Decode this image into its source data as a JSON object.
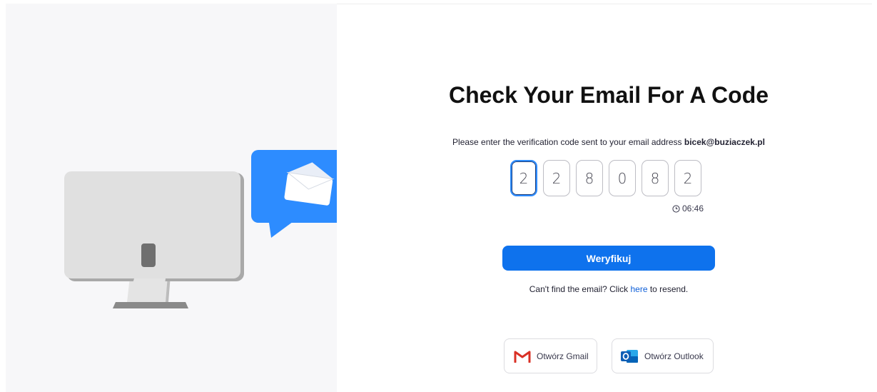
{
  "heading": "Check Your Email For A Code",
  "instruction": {
    "text": "Please enter the verification code sent to your email address",
    "email": "bicek@buziaczek.pl"
  },
  "code": {
    "digits": [
      "2",
      "2",
      "8",
      "0",
      "8",
      "2"
    ],
    "timer": "06:46"
  },
  "verify_button": "Weryfikuj",
  "resend": {
    "prefix": "Can't find the email? Click",
    "link": "here",
    "suffix": "to resend."
  },
  "mail_buttons": {
    "gmail": "Otwórz Gmail",
    "outlook": "Otwórz Outlook"
  },
  "colors": {
    "accent": "#0e72ed",
    "bubble": "#2d8cff",
    "link": "#0e5fd8",
    "left_panel": "#f7f7f9"
  },
  "icons": [
    "monitor-illustration",
    "email-bubble-icon",
    "clock-icon",
    "gmail-icon",
    "outlook-icon"
  ]
}
